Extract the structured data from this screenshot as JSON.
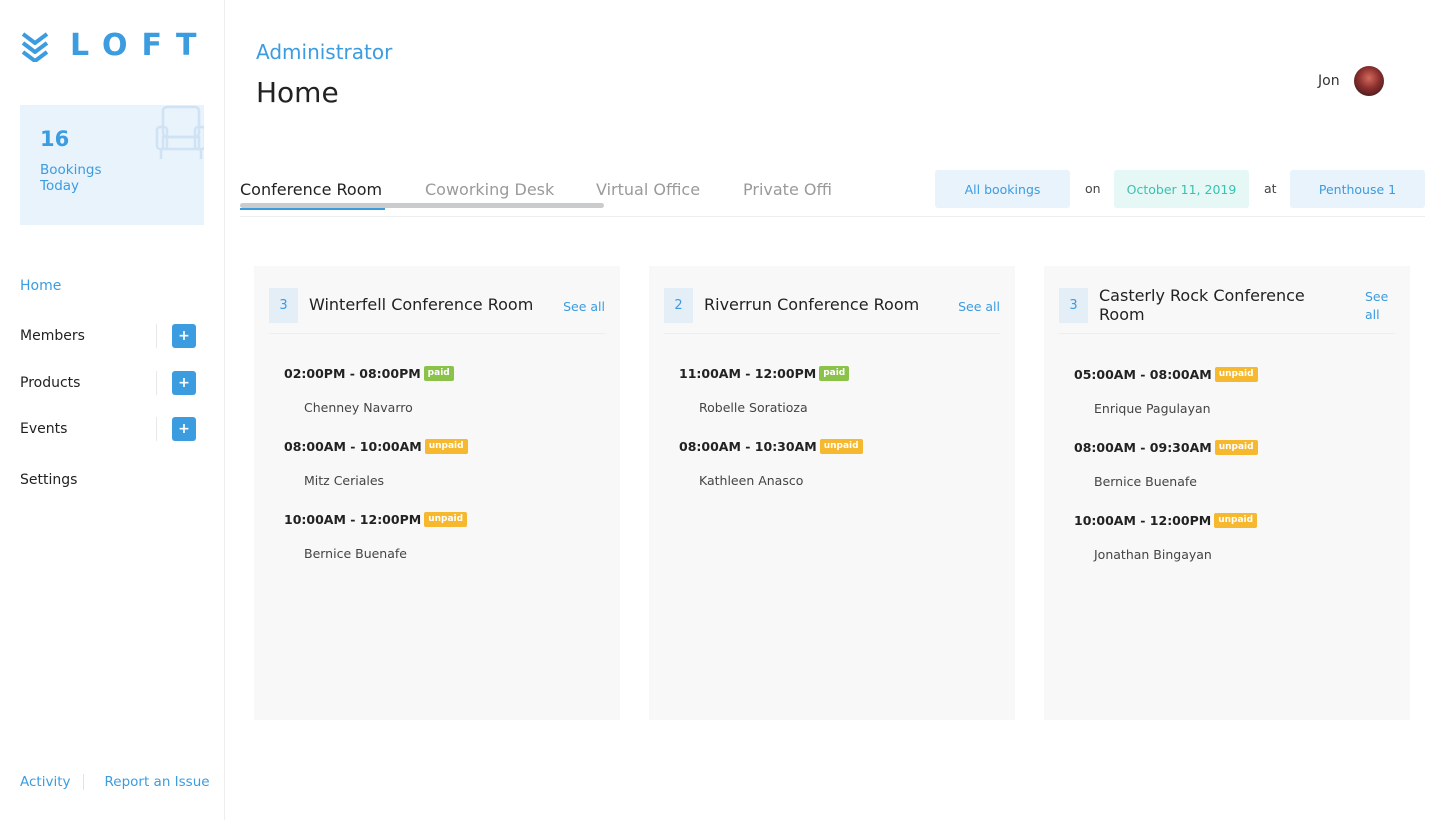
{
  "app": {
    "logo_text": "LOFT"
  },
  "stat": {
    "value": "16",
    "label": "Bookings Today"
  },
  "nav": {
    "home": "Home",
    "members": "Members",
    "products": "Products",
    "events": "Events",
    "settings": "Settings",
    "add_symbol": "+"
  },
  "footer": {
    "activity": "Activity",
    "report": "Report an Issue"
  },
  "header": {
    "role": "Administrator",
    "title": "Home"
  },
  "user": {
    "name": "Jon"
  },
  "tabs": [
    "Conference Room",
    "Coworking Desk",
    "Virtual Office",
    "Private Offi"
  ],
  "filters": {
    "bookings": "All bookings",
    "on_word": "on",
    "date": "October 11, 2019",
    "at_word": "at",
    "location": "Penthouse 1"
  },
  "rooms": [
    {
      "count": "3",
      "name": "Winterfell Conference Room",
      "see_all": "See all",
      "bookings": [
        {
          "time": "02:00PM - 08:00PM",
          "status": "paid",
          "name": "Chenney Navarro"
        },
        {
          "time": "08:00AM - 10:00AM",
          "status": "unpaid",
          "name": "Mitz Ceriales"
        },
        {
          "time": "10:00AM - 12:00PM",
          "status": "unpaid",
          "name": "Bernice Buenafe"
        }
      ]
    },
    {
      "count": "2",
      "name": "Riverrun Conference Room",
      "see_all": "See all",
      "bookings": [
        {
          "time": "11:00AM - 12:00PM",
          "status": "paid",
          "name": "Robelle Soratioza"
        },
        {
          "time": "08:00AM - 10:30AM",
          "status": "unpaid",
          "name": "Kathleen Anasco"
        }
      ]
    },
    {
      "count": "3",
      "name": "Casterly Rock Conference Room",
      "see_all": "See all",
      "bookings": [
        {
          "time": "05:00AM - 08:00AM",
          "status": "unpaid",
          "name": "Enrique Pagulayan"
        },
        {
          "time": "08:00AM - 09:30AM",
          "status": "unpaid",
          "name": "Bernice Buenafe"
        },
        {
          "time": "10:00AM - 12:00PM",
          "status": "unpaid",
          "name": "Jonathan Bingayan"
        }
      ]
    }
  ],
  "colors": {
    "accent": "#3b9ce0",
    "paid": "#8bc34a",
    "unpaid": "#f5b82e",
    "teal": "#38c2b0"
  },
  "icons": {
    "logo": "stacked-chevrons-icon",
    "stat": "armchair-icon",
    "add": "plus-icon"
  }
}
